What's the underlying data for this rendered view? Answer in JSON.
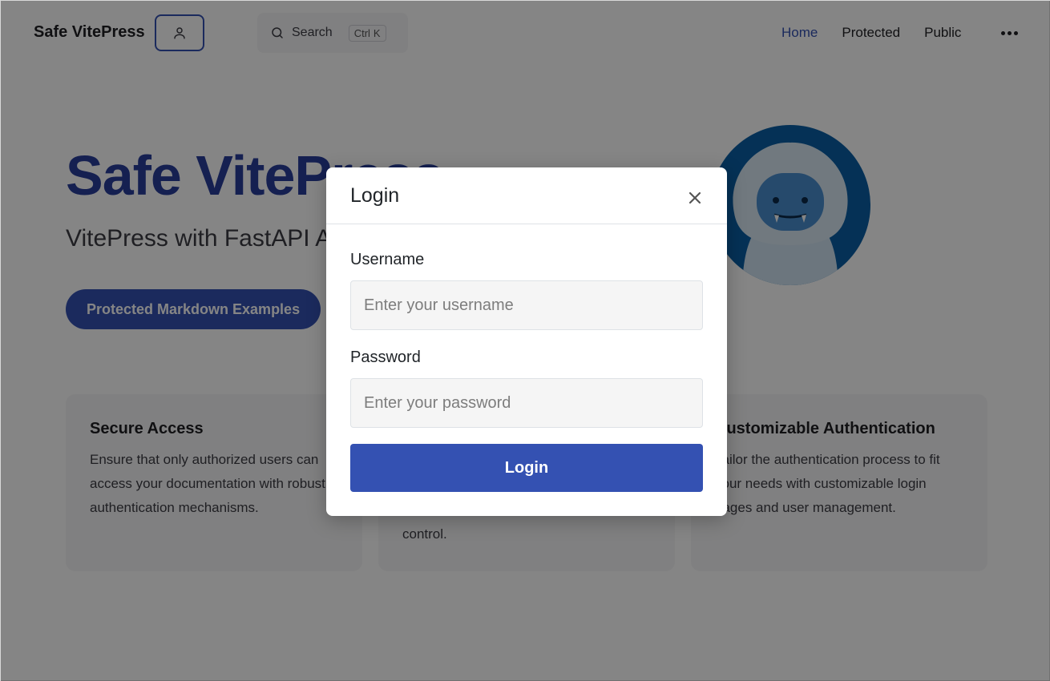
{
  "navbar": {
    "brand": "Safe VitePress",
    "search_label": "Search",
    "search_kbd": [
      "Ctrl",
      "K"
    ],
    "links": [
      {
        "label": "Home",
        "active": true
      },
      {
        "label": "Protected",
        "active": false
      },
      {
        "label": "Public",
        "active": false
      }
    ]
  },
  "hero": {
    "title": "Safe VitePress",
    "tagline": "VitePress with FastAPI Authentication",
    "action": "Protected Markdown Examples"
  },
  "features": [
    {
      "title": "Secure Access",
      "desc": "Ensure that only authorized users can access your documentation with robust authentication mechanisms."
    },
    {
      "title": "",
      "desc": "control."
    },
    {
      "title": "Customizable Authentication",
      "desc": "Tailor the authentication process to fit your needs with customizable login pages and user management."
    }
  ],
  "modal": {
    "title": "Login",
    "username_label": "Username",
    "username_placeholder": "Enter your username",
    "password_label": "Password",
    "password_placeholder": "Enter your password",
    "submit_label": "Login"
  },
  "colors": {
    "accent": "#3451b2",
    "overlay": "rgba(0,0,0,0.48)"
  }
}
